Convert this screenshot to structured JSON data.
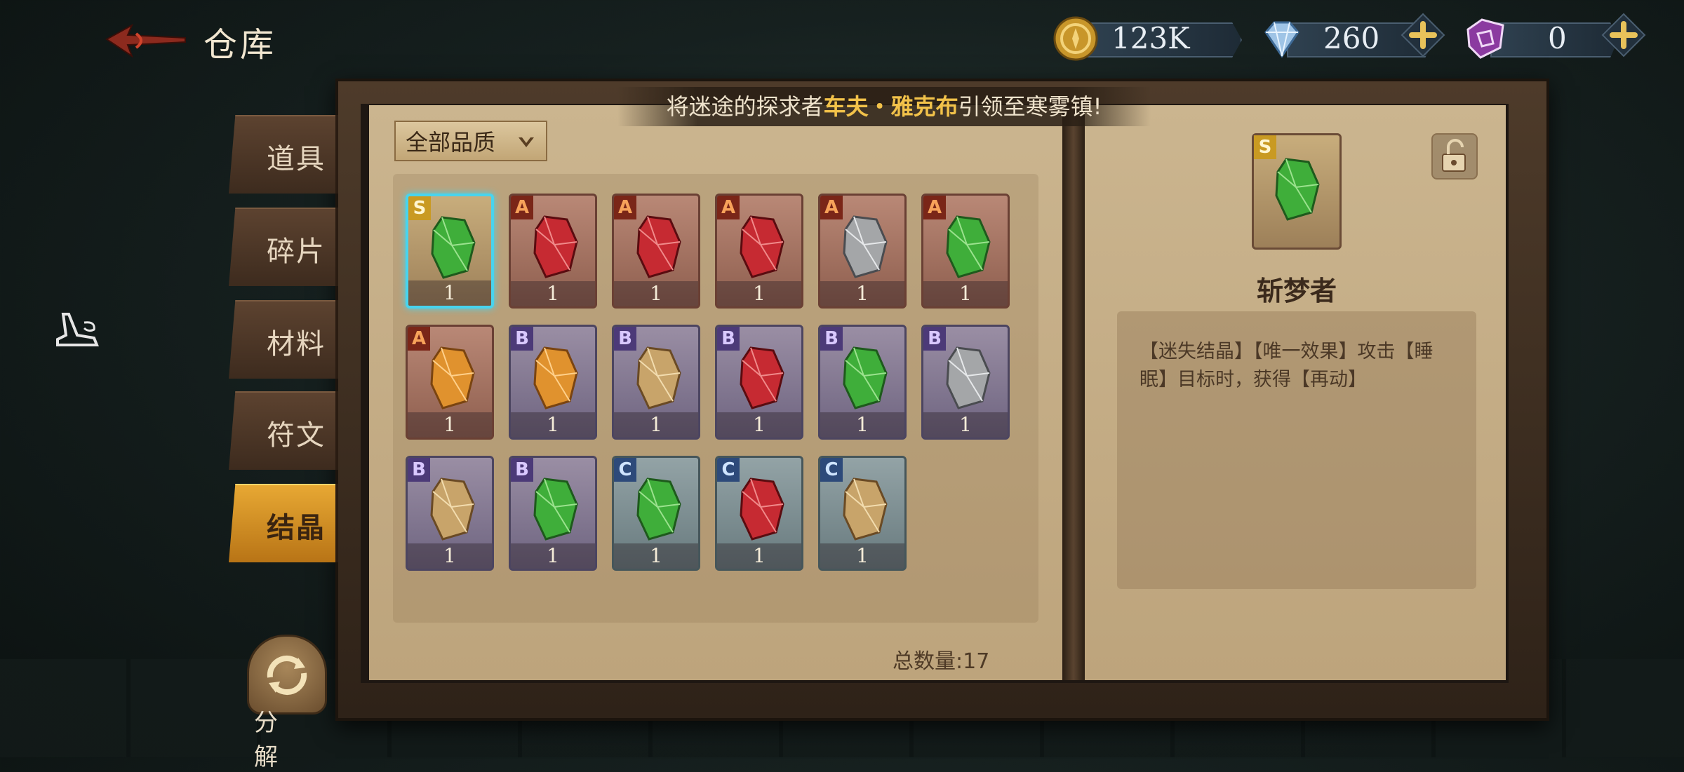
{
  "header": {
    "title": "仓库",
    "currencies": [
      {
        "name": "gold-coin-icon",
        "value": "123K",
        "has_plus": false
      },
      {
        "name": "diamond-icon",
        "value": "260",
        "has_plus": true
      },
      {
        "name": "purple-gem-icon",
        "value": "0",
        "has_plus": true
      }
    ]
  },
  "tabs": [
    {
      "label": "道具",
      "active": false
    },
    {
      "label": "碎片",
      "active": false
    },
    {
      "label": "材料",
      "active": false
    },
    {
      "label": "符文",
      "active": false
    },
    {
      "label": "结晶",
      "active": true
    }
  ],
  "decompose_label": "分 解",
  "banner": {
    "prefix": "将迷途的探求者",
    "highlight": "车夫・雅克布",
    "suffix": "引领至寒雾镇!"
  },
  "filter_label": "全部品质",
  "colors": {
    "S": "#c99a22",
    "A": "#7a2618",
    "B": "#4c3a78",
    "C": "#2d4a7a",
    "selected": "#48d4ee",
    "highlight": "#f2c24a"
  },
  "items": [
    {
      "grade": "S",
      "gem": "green",
      "count": "1",
      "selected": true
    },
    {
      "grade": "A",
      "gem": "red",
      "count": "1"
    },
    {
      "grade": "A",
      "gem": "red",
      "count": "1"
    },
    {
      "grade": "A",
      "gem": "red",
      "count": "1"
    },
    {
      "grade": "A",
      "gem": "gray",
      "count": "1"
    },
    {
      "grade": "A",
      "gem": "green",
      "count": "1"
    },
    {
      "grade": "A",
      "gem": "orange",
      "count": "1"
    },
    {
      "grade": "B",
      "gem": "orange",
      "count": "1"
    },
    {
      "grade": "B",
      "gem": "tan",
      "count": "1"
    },
    {
      "grade": "B",
      "gem": "red",
      "count": "1"
    },
    {
      "grade": "B",
      "gem": "green",
      "count": "1"
    },
    {
      "grade": "B",
      "gem": "gray",
      "count": "1"
    },
    {
      "grade": "B",
      "gem": "tan",
      "count": "1"
    },
    {
      "grade": "B",
      "gem": "green",
      "count": "1"
    },
    {
      "grade": "C",
      "gem": "green",
      "count": "1"
    },
    {
      "grade": "C",
      "gem": "red",
      "count": "1"
    },
    {
      "grade": "C",
      "gem": "tan",
      "count": "1"
    }
  ],
  "total_label": "总数量:17",
  "detail": {
    "grade": "S",
    "name": "斩梦者",
    "description": "【迷失结晶】【唯一效果】攻击【睡眠】目标时，获得【再动】"
  }
}
